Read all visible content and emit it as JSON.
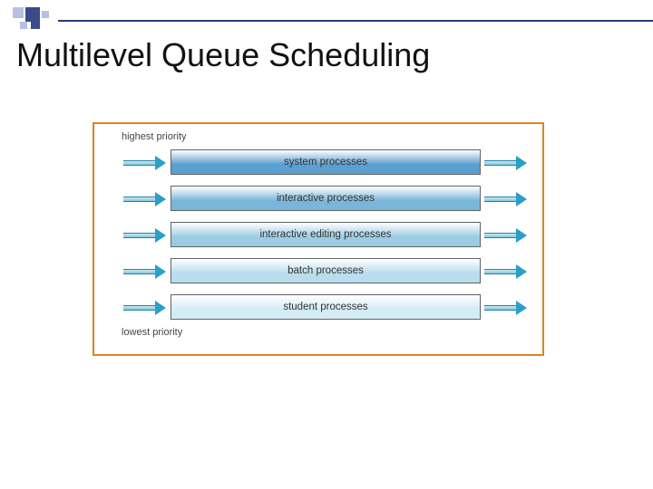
{
  "title": "Multilevel Queue Scheduling",
  "labels": {
    "top": "highest priority",
    "bottom": "lowest priority"
  },
  "queues": [
    {
      "name": "system processes",
      "color": "#5a9fcf"
    },
    {
      "name": "interactive processes",
      "color": "#7ab6d9"
    },
    {
      "name": "interactive editing processes",
      "color": "#9ccce3"
    },
    {
      "name": "batch processes",
      "color": "#b9dded"
    },
    {
      "name": "student processes",
      "color": "#d3ecf5"
    }
  ],
  "accent": {
    "frame": "#d9851f",
    "decoDark": "#3b4a8a",
    "decoLight": "#b8c0e0"
  }
}
